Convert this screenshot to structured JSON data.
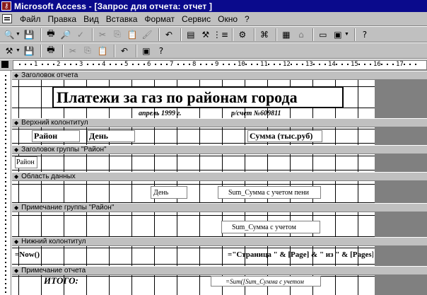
{
  "window": {
    "app": "Microsoft Access",
    "title": "Microsoft Access - [Запрос для отчета: отчет ]"
  },
  "menu": {
    "items": [
      "Файл",
      "Правка",
      "Вид",
      "Вставка",
      "Формат",
      "Сервис",
      "Окно",
      "?"
    ]
  },
  "toolbar1": {
    "icons": [
      "view-icon",
      "save-icon",
      "print-icon",
      "print-preview-icon",
      "spelling-icon",
      "cut-icon",
      "copy-icon",
      "paste-icon",
      "format-painter-icon",
      "undo-icon",
      "field-list-icon",
      "toolbox-icon",
      "sorting-grouping-icon",
      "autoformat-icon",
      "code-icon",
      "build-icon",
      "properties-icon",
      "database-window-icon",
      "new-object-icon",
      "help-icon"
    ]
  },
  "toolbar2": {
    "icons": [
      "tools-icon",
      "save-icon",
      "print-icon",
      "cut-icon",
      "copy-icon",
      "paste-icon",
      "undo-icon",
      "window-icon",
      "help-icon"
    ]
  },
  "ruler": {
    "numbers": [
      "1",
      "2",
      "3",
      "4",
      "5",
      "6",
      "7",
      "8",
      "9",
      "10",
      "11",
      "12",
      "13",
      "14",
      "15",
      "16",
      "17"
    ]
  },
  "sections": {
    "report_header": "Заголовок отчета",
    "page_header": "Верхний колонтитул",
    "group_header": "Заголовок группы \"Район\"",
    "detail": "Область данных",
    "group_footer": "Примечание группы \"Район\"",
    "page_footer": "Нижний колонтитул",
    "report_footer": "Примечание отчета"
  },
  "controls": {
    "report_title": "Платежи за газ по районам города",
    "date_label": "апрель 1999 г.",
    "account_label": "р/счет №609811",
    "col_district": "Район",
    "col_day": "День",
    "col_sum": "Сумма (тыс.руб)",
    "group_district": "Район",
    "detail_day": "День",
    "detail_sum": "Sum_Сумма с учетом пени",
    "group_sum": "Sum_Сумма с учетом",
    "now_expr": "=Now()",
    "page_expr": "=\"Страница \" & [Page] & \" из \" & [Pages]",
    "total_label": "ИТОГО:",
    "total_sum": "=Sum([Sum_Сумма с учетом"
  }
}
